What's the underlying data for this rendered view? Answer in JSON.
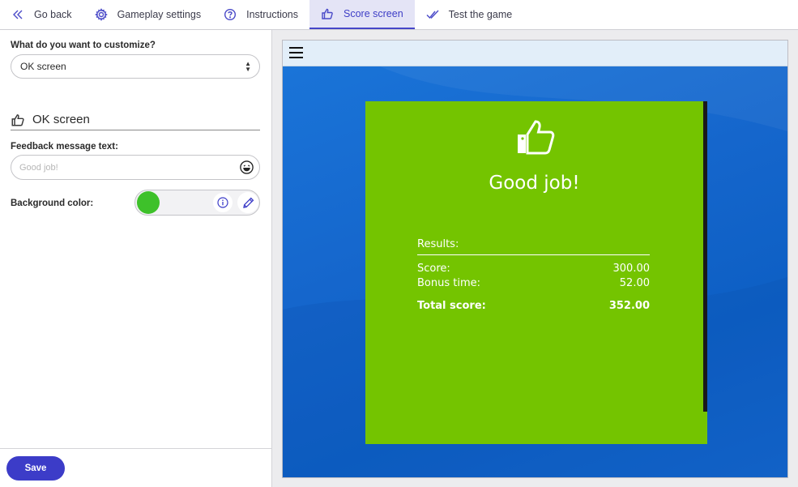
{
  "nav": {
    "items": [
      {
        "label": "Go back",
        "icon": "chevrons-left-icon"
      },
      {
        "label": "Gameplay settings",
        "icon": "gear-icon"
      },
      {
        "label": "Instructions",
        "icon": "question-circle-icon"
      },
      {
        "label": "Score screen",
        "icon": "thumbs-up-icon",
        "active": true
      },
      {
        "label": "Test the game",
        "icon": "double-check-icon"
      }
    ]
  },
  "left": {
    "customize_label": "What do you want to customize?",
    "customize_value": "OK screen",
    "section_title": "OK screen",
    "feedback_label": "Feedback message text:",
    "feedback_placeholder": "Good job!",
    "bg_label": "Background color:",
    "bg_color": "#3ec12a",
    "save_label": "Save"
  },
  "preview": {
    "card_color": "#74c400",
    "message": "Good job!",
    "results_label": "Results:",
    "rows": [
      {
        "label": "Score:",
        "value": "300.00"
      },
      {
        "label": "Bonus time:",
        "value": "52.00"
      }
    ],
    "total": {
      "label": "Total score:",
      "value": "352.00"
    }
  },
  "colors": {
    "accent": "#3c3cc8",
    "active_tab_bg": "#e4e4f6"
  }
}
